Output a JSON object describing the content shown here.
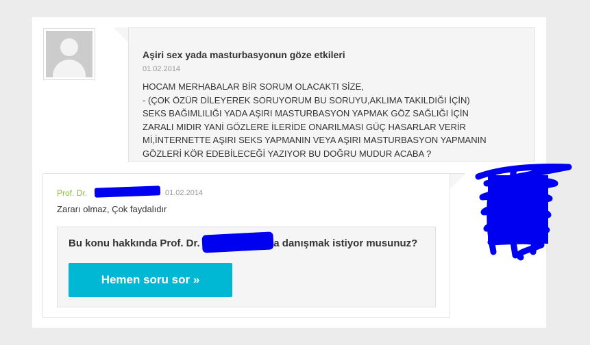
{
  "question": {
    "title": "Aşiri sex yada masturbasyonun göze etkileri",
    "date": "01.02.2014",
    "lines": [
      "HOCAM MERHABALAR BİR SORUM OLACAKTI SİZE,",
      "- (ÇOK ÖZÜR DİLEYEREK SORUYORUM BU SORUYU,AKLIMA TAKILDIĞI İÇİN)",
      "SEKS BAĞIMLILIĞI YADA AŞIRI MASTURBASYON YAPMAK GÖZ SAĞLIĞI İÇİN",
      "ZARALI MIDIR YANİ GÖZLERE İLERİDE ONARILMASI GÜÇ HASARLAR VERİR",
      "Mİ,İNTERNETTE AŞIRI SEKS YAPMANIN VEYA AŞIRI MASTURBASYON YAPMANIN",
      "GÖZLERİ KÖR EDEBİLECEĞİ YAZIYOR BU DOĞRU MUDUR ACABA ?"
    ]
  },
  "answer": {
    "author_prefix": "Prof. Dr.",
    "date": "01.02.2014",
    "text": "Zararı olmaz, Çok faydalıdır"
  },
  "cta": {
    "question_prefix": "Bu konu hakkında Prof. Dr.",
    "question_suffix": "'a danışmak istiyor musunuz?",
    "button_label": "Hemen soru sor »",
    "button_color": "#00b7d4"
  },
  "colors": {
    "author_name": "#8bbc3a",
    "redaction": "#0000f0"
  }
}
